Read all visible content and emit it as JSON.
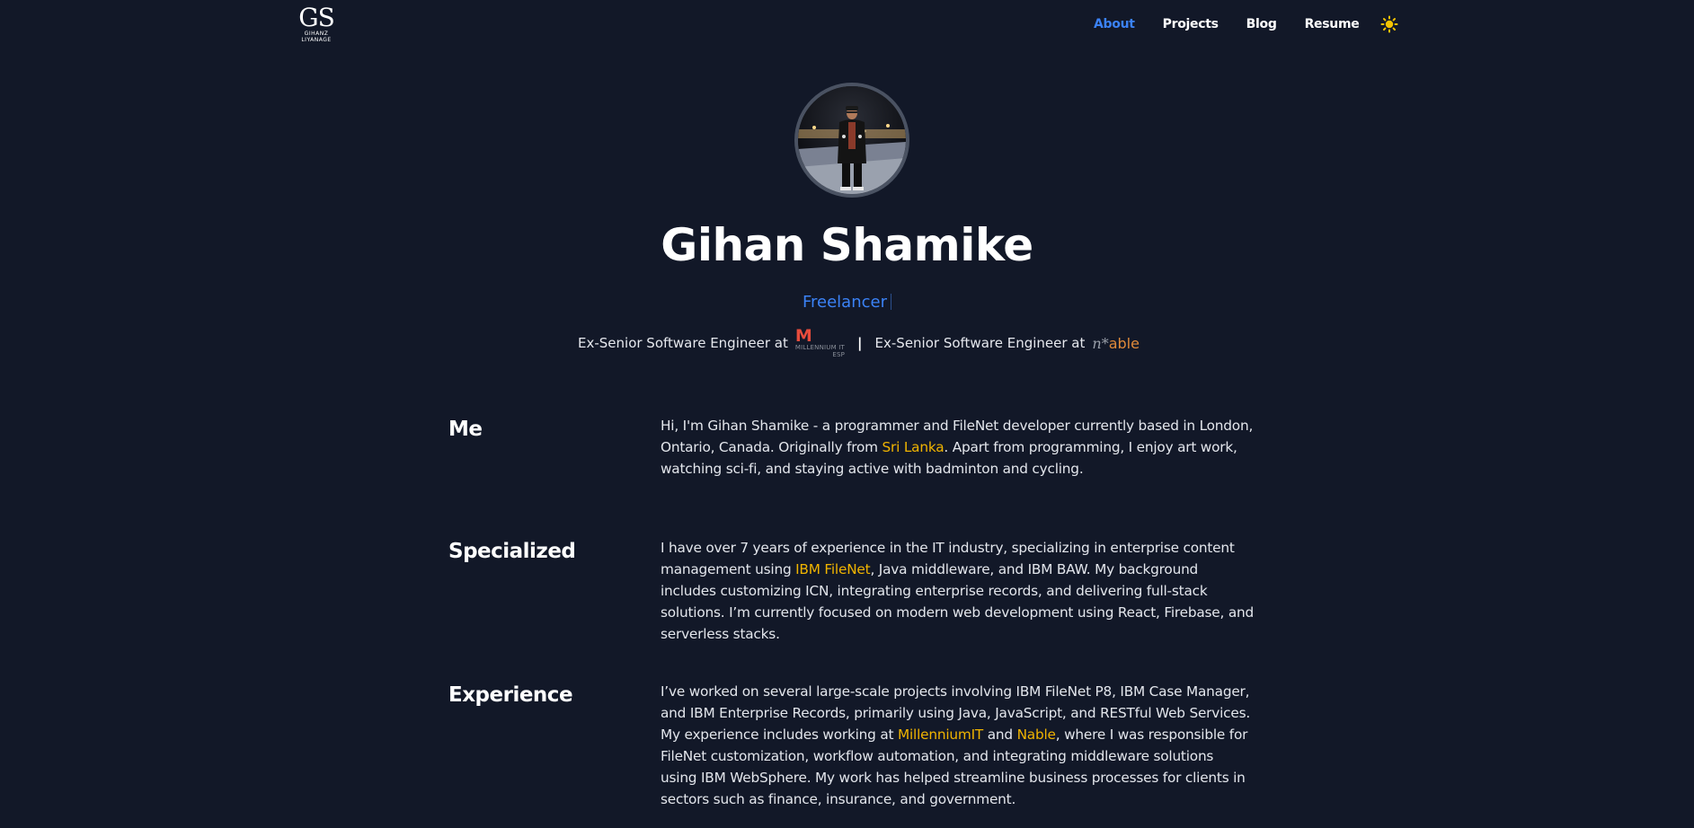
{
  "header": {
    "logo_mark": "GS",
    "logo_sub_line1": "GIHANZ",
    "logo_sub_line2": "LIYANAGE",
    "nav": [
      {
        "label": "About",
        "active": true
      },
      {
        "label": "Projects",
        "active": false
      },
      {
        "label": "Blog",
        "active": false
      },
      {
        "label": "Resume",
        "active": false
      }
    ],
    "theme_icon": "sun-icon"
  },
  "hero": {
    "name": "Gihan Shamike",
    "role": "Freelancer",
    "employers": [
      {
        "text": "Ex-Senior Software Engineer at",
        "logo": "millennium-it-esp-logo",
        "logo_text": "M",
        "logo_caption": "MILLENNIUM IT",
        "logo_caption_2": "ESP"
      },
      {
        "text": "Ex-Senior Software Engineer at",
        "logo": "n-able-logo",
        "logo_text": "n",
        "logo_star": "*",
        "logo_word": "able"
      }
    ],
    "separator": "|"
  },
  "sections": {
    "me": {
      "title": "Me",
      "p1": "Hi, I'm Gihan Shamike - a programmer and FileNet developer currently based in London, Ontario, Canada. Originally from ",
      "link1": "Sri Lanka",
      "p2": ". Apart from programming, I enjoy art work, watching sci-fi, and staying active with badminton and cycling."
    },
    "specialized": {
      "title": "Specialized",
      "p1": "I have over 7 years of experience in the IT industry, specializing in enterprise content management using ",
      "link1": "IBM FileNet",
      "p2": ", Java middleware, and IBM BAW. My background includes customizing ICN, integrating enterprise records, and delivering full-stack solutions. I’m currently focused on modern web development using React, Firebase, and serverless stacks."
    },
    "experience": {
      "title": "Experience",
      "p1": "I’ve worked on several large-scale projects involving IBM FileNet P8, IBM Case Manager, and IBM Enterprise Records, primarily using Java, JavaScript, and RESTful Web Services. My experience includes working at ",
      "link1": "MillenniumIT",
      "mid": " and ",
      "link2": "Nable",
      "p2": ", where I was responsible for FileNet customization, workflow automation, and integrating middleware solutions using IBM WebSphere. My work has helped streamline business processes for clients in sectors such as finance, insurance, and government."
    }
  },
  "colors": {
    "background": "#121828",
    "accent_blue": "#3b82f6",
    "highlight": "#f0b400",
    "sun": "#f5c400"
  }
}
